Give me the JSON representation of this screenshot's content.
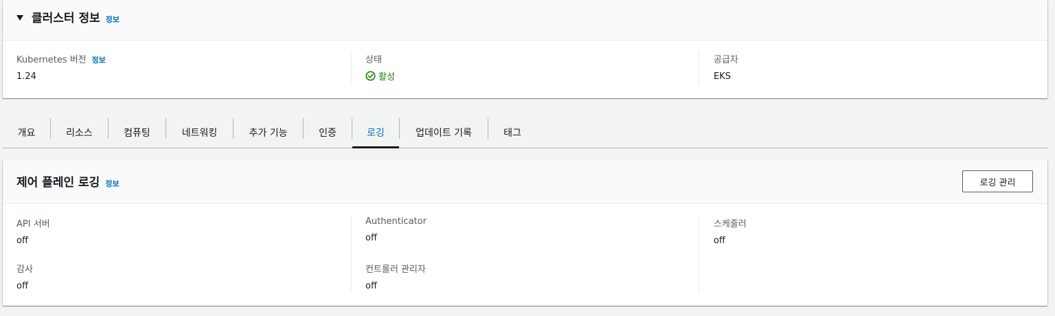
{
  "cluster_info": {
    "title": "클러스터 정보",
    "info_link": "정보",
    "kubernetes_version": {
      "label": "Kubernetes 버전",
      "info_link": "정보",
      "value": "1.24"
    },
    "status": {
      "label": "상태",
      "value": "활성",
      "icon": "check-circle-icon",
      "color": "#1d8102"
    },
    "provider": {
      "label": "공급자",
      "value": "EKS"
    }
  },
  "tabs": [
    {
      "label": "개요"
    },
    {
      "label": "리소스"
    },
    {
      "label": "컴퓨팅"
    },
    {
      "label": "네트워킹"
    },
    {
      "label": "추가 기능"
    },
    {
      "label": "인증"
    },
    {
      "label": "로깅",
      "active": true
    },
    {
      "label": "업데이트 기록"
    },
    {
      "label": "태그"
    }
  ],
  "control_plane_logging": {
    "title": "제어 플레인 로깅",
    "info_link": "정보",
    "manage_button": "로깅 관리",
    "items": {
      "api_server": {
        "label": "API 서버",
        "value": "off"
      },
      "authenticator": {
        "label": "Authenticator",
        "value": "off"
      },
      "scheduler": {
        "label": "스케줄러",
        "value": "off"
      },
      "audit": {
        "label": "감사",
        "value": "off"
      },
      "controller_manager": {
        "label": "컨트롤러 관리자",
        "value": "off"
      }
    }
  },
  "colors": {
    "link": "#0073bb",
    "success": "#1d8102",
    "text": "#16191f",
    "label": "#545b64"
  }
}
